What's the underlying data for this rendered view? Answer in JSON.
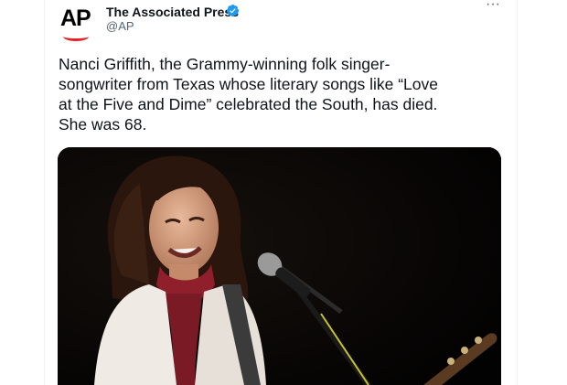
{
  "tweet": {
    "author_name": "The Associated Press",
    "author_handle": "@AP",
    "avatar_text": "AP",
    "verified": true,
    "text": "Nanci Griffith, the Grammy-winning folk singer-\nsongwriter from Texas whose literary songs like “Love\nat the Five and Dime” celebrated the South, has died.\nShe was 68.",
    "more_label": "···",
    "media": {
      "icon": "photo"
    }
  },
  "colors": {
    "text": "#0f1419",
    "secondary": "#536471",
    "verified": "#1d9bf0",
    "ap_red": "#e4202a"
  }
}
